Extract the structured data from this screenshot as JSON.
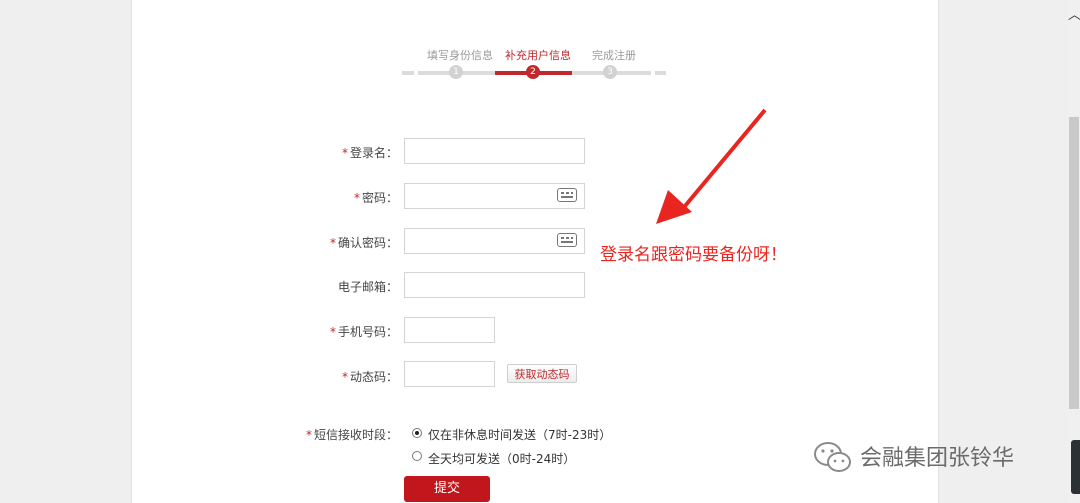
{
  "steps": [
    {
      "label": "填写身份信息",
      "num": "1",
      "active": false
    },
    {
      "label": "补充用户信息",
      "num": "2",
      "active": true
    },
    {
      "label": "完成注册",
      "num": "3",
      "active": false
    }
  ],
  "form": {
    "username_label": "登录名：",
    "password_label": "密码：",
    "confirm_label": "确认密码：",
    "email_label": "电子邮箱：",
    "phone_label": "手机号码：",
    "code_label": "动态码：",
    "get_code_button": "获取动态码",
    "sms_time_label": "短信接收时段：",
    "sms_option_1": "仅在非休息时间发送（7时-23时）",
    "sms_option_2": "全天均可发送（0时-24时）",
    "submit_label": "提交",
    "required_mark": "*"
  },
  "annotation": "登录名跟密码要备份呀！",
  "watermark": "会融集团张铃华",
  "colors": {
    "accent": "#c0282d",
    "annotation": "#e8251f"
  }
}
